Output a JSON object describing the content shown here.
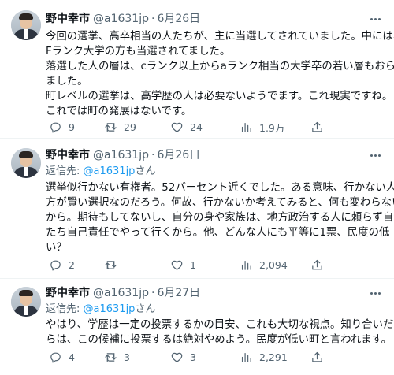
{
  "tweets": [
    {
      "name": "野中幸市",
      "handle": "@a1631jp",
      "separator": "·",
      "date": "6月26日",
      "reply_label": "",
      "reply_mention": "",
      "reply_suffix": "",
      "lines": [
        "今回の選挙、高卒相当の人たちが、主に当選してされていました。中には、",
        "Fランク大学の方も当選されてました。",
        "落選した人の層は、cランク以上からaランク相当の大学卒の若い層もおられ",
        "ました。",
        "町レベルの選挙は、高学歴の人は必要ないようでます。これ現実ですね。",
        "これでは町の発展はないです。"
      ],
      "replies": "9",
      "retweets": "29",
      "likes": "24",
      "views": "1.9万"
    },
    {
      "name": "野中幸市",
      "handle": "@a1631jp",
      "separator": "·",
      "date": "6月26日",
      "reply_label": "返信先: ",
      "reply_mention": "@a1631jp",
      "reply_suffix": "さん",
      "lines": [
        "選挙似行かない有権者。52パーセント近くでした。ある意味、行かない人の",
        "方が賢い選択なのだろう。何故、行かないか考えてみると、何も変わらない",
        "から。期待もしてないし、自分の身や家族は、地方政治する人に頼らず自分",
        "たち自己責任でやって行くから。他、どんな人にも平等に1票、民度の低",
        "い？"
      ],
      "replies": "2",
      "retweets": "",
      "likes": "1",
      "views": "2,094"
    },
    {
      "name": "野中幸市",
      "handle": "@a1631jp",
      "separator": "·",
      "date": "6月27日",
      "reply_label": "返信先: ",
      "reply_mention": "@a1631jp",
      "reply_suffix": "さん",
      "lines": [
        "やはり、学歴は一定の投票するかの目安、これも大切な視点。知り合いだか",
        "らは、この候補に投票するは絶対やめよう。民度が低い町と言われます。"
      ],
      "replies": "4",
      "retweets": "3",
      "likes": "3",
      "views": "2,291"
    }
  ],
  "icons": {
    "reply": "comment-bubble-icon",
    "retweet": "retweet-arrows-icon",
    "like": "heart-icon",
    "views": "bar-chart-icon",
    "share": "share-upload-icon",
    "more": "more-dots-icon"
  },
  "colors": {
    "text": "#0f1419",
    "secondary": "#536471",
    "link": "#1d9bf0",
    "divider": "#eff3f4"
  }
}
